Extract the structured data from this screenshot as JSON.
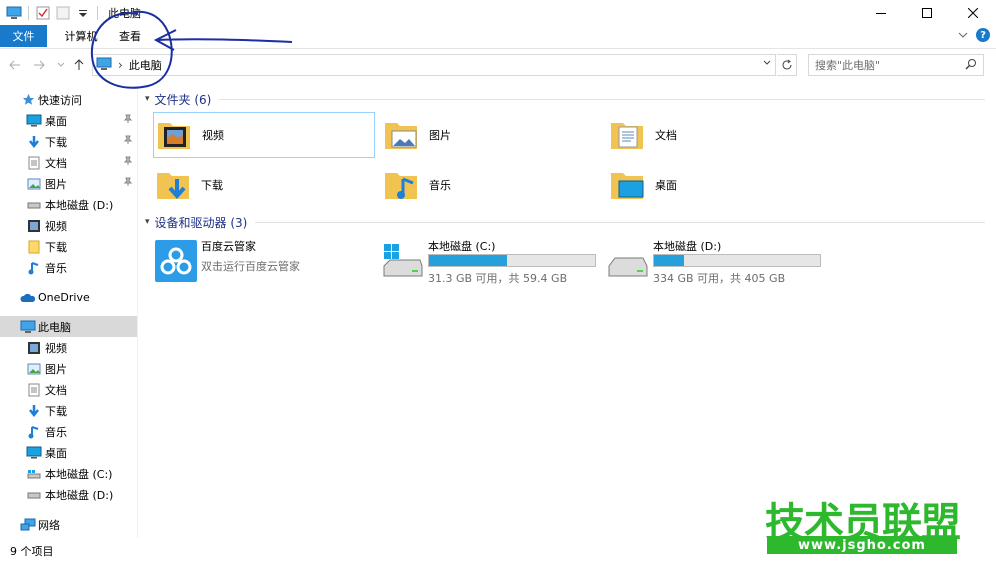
{
  "window": {
    "title": "此电脑",
    "controls": [
      "minimize-icon",
      "maximize-icon",
      "close-icon"
    ]
  },
  "ribbon": {
    "tabs": [
      {
        "label": "文件",
        "active": true
      },
      {
        "label": "计算机"
      },
      {
        "label": "查看"
      }
    ]
  },
  "address": {
    "crumb": "此电脑",
    "search_placeholder": "搜索\"此电脑\""
  },
  "sidebar": {
    "quick_access": "快速访问",
    "quick_items": [
      "桌面",
      "下载",
      "文档",
      "图片",
      "本地磁盘 (D:)",
      "视频",
      "下载",
      "音乐"
    ],
    "onedrive": "OneDrive",
    "this_pc": "此电脑",
    "pc_items": [
      "视频",
      "图片",
      "文档",
      "下载",
      "音乐",
      "桌面",
      "本地磁盘 (C:)",
      "本地磁盘 (D:)"
    ],
    "network": "网络"
  },
  "folders": {
    "header": "文件夹 (6)",
    "items": [
      "视频",
      "图片",
      "文档",
      "下载",
      "音乐",
      "桌面"
    ]
  },
  "devices": {
    "header": "设备和驱动器 (3)",
    "baidu": {
      "name": "百度云管家",
      "sub": "双击运行百度云管家"
    },
    "drive_c": {
      "name": "本地磁盘 (C:)",
      "size": "31.3 GB 可用，共 59.4 GB",
      "used_fraction": 0.47
    },
    "drive_d": {
      "name": "本地磁盘 (D:)",
      "size": "334 GB 可用，共 405 GB",
      "used_fraction": 0.18
    }
  },
  "status": {
    "count": "9 个项目"
  },
  "watermark": {
    "title": "技术员联盟",
    "url": "www.jsgho.com"
  },
  "colors": {
    "accent": "#1979ca",
    "drive_bar": "#26a0da",
    "header_text": "#1e3287",
    "watermark": "#2eb82e"
  }
}
